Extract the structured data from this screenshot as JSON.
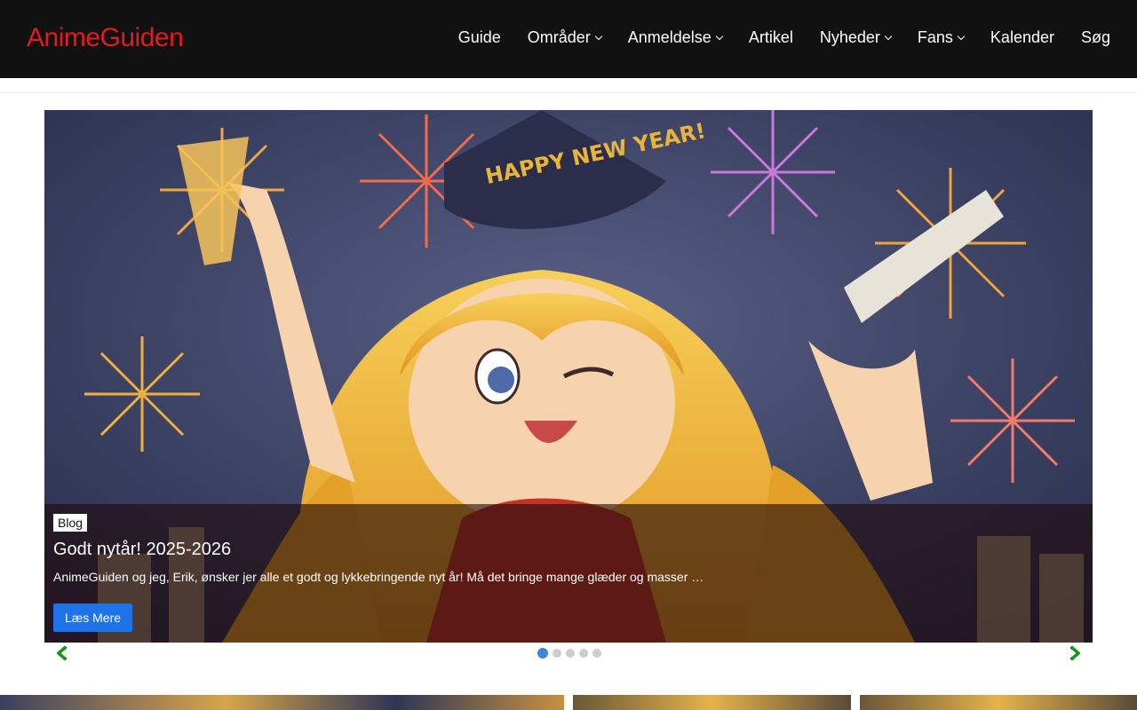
{
  "site": {
    "logo": "AnimeGuiden",
    "logo_color": "#e31b1b"
  },
  "nav": {
    "items": [
      {
        "label": "Guide",
        "dropdown": false
      },
      {
        "label": "Områder",
        "dropdown": true
      },
      {
        "label": "Anmeldelse",
        "dropdown": true
      },
      {
        "label": "Artikel",
        "dropdown": false
      },
      {
        "label": "Nyheder",
        "dropdown": true
      },
      {
        "label": "Fans",
        "dropdown": true
      },
      {
        "label": "Kalender",
        "dropdown": false
      },
      {
        "label": "Søg",
        "dropdown": false
      }
    ]
  },
  "slider": {
    "art_text": "HAPPY NEW YEAR!",
    "category": "Blog",
    "title": "Godt nytår! 2025-2026",
    "excerpt": "AnimeGuiden og jeg, Erik, ønsker jer alle et godt og lykkebringende nyt år! Må det bringe mange glæder og masser …",
    "button_label": "Læs Mere",
    "total_slides": 5,
    "active_slide": 1,
    "accent_color": "#1e73e8",
    "arrow_color": "#1aa01a",
    "icons": {
      "prev": "chevron-left-icon",
      "next": "chevron-right-icon"
    }
  }
}
